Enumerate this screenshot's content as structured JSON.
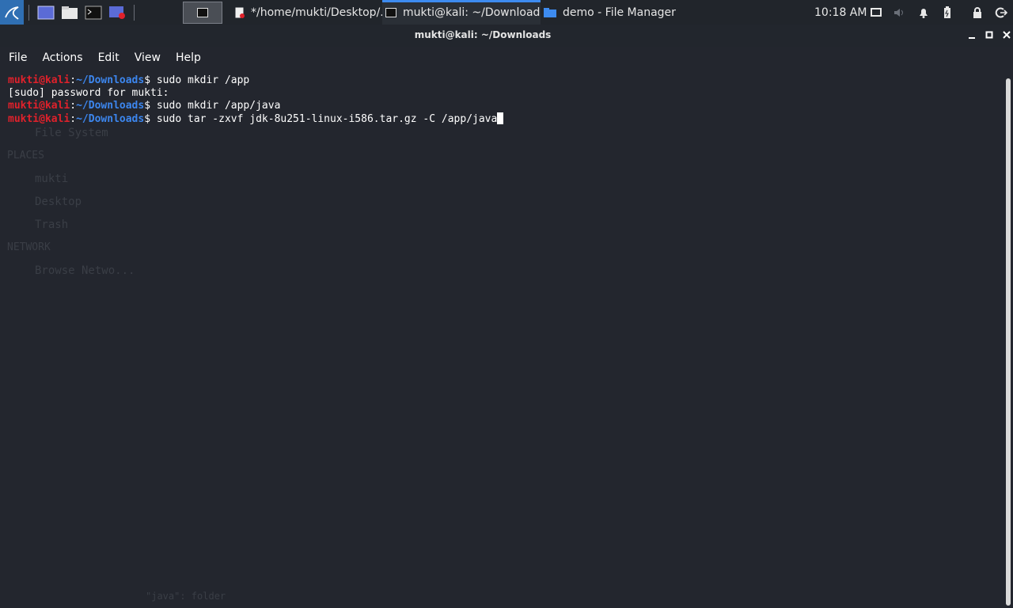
{
  "panel": {
    "tasks": [
      {
        "label": "*/home/mukti/Desktop/..."
      },
      {
        "label": "mukti@kali: ~/Downloads"
      },
      {
        "label": "demo - File Manager"
      }
    ],
    "clock": "10:18 AM"
  },
  "window": {
    "title": "mukti@kali: ~/Downloads",
    "menu": [
      "File",
      "Actions",
      "Edit",
      "View",
      "Help"
    ]
  },
  "terminal": {
    "lines": [
      {
        "user": "mukti@kali",
        "colon": ":",
        "path": "~/Downloads",
        "dollar": "$",
        "cmd": " sudo mkdir /app"
      },
      {
        "text": "[sudo] password for mukti:"
      },
      {
        "user": "mukti@kali",
        "colon": ":",
        "path": "~/Downloads",
        "dollar": "$",
        "cmd": " sudo mkdir /app/java"
      },
      {
        "user": "mukti@kali",
        "colon": ":",
        "path": "~/Downloads",
        "dollar": "$",
        "cmd": " sudo tar -zxvf jdk-8u251-linux-i586.tar.gz -C /app/java"
      }
    ]
  },
  "ghost": {
    "filesystem": "File System",
    "places": "PLACES",
    "mukti": "mukti",
    "desktop": "Desktop",
    "trash": "Trash",
    "network": "NETWORK",
    "browse": "Browse Netwo...",
    "status": "\"java\": folder"
  },
  "colors": {
    "prompt_user": "#e0212b",
    "prompt_path": "#3c86ee",
    "background": "#23262e",
    "accent": "#3d8bf0"
  }
}
